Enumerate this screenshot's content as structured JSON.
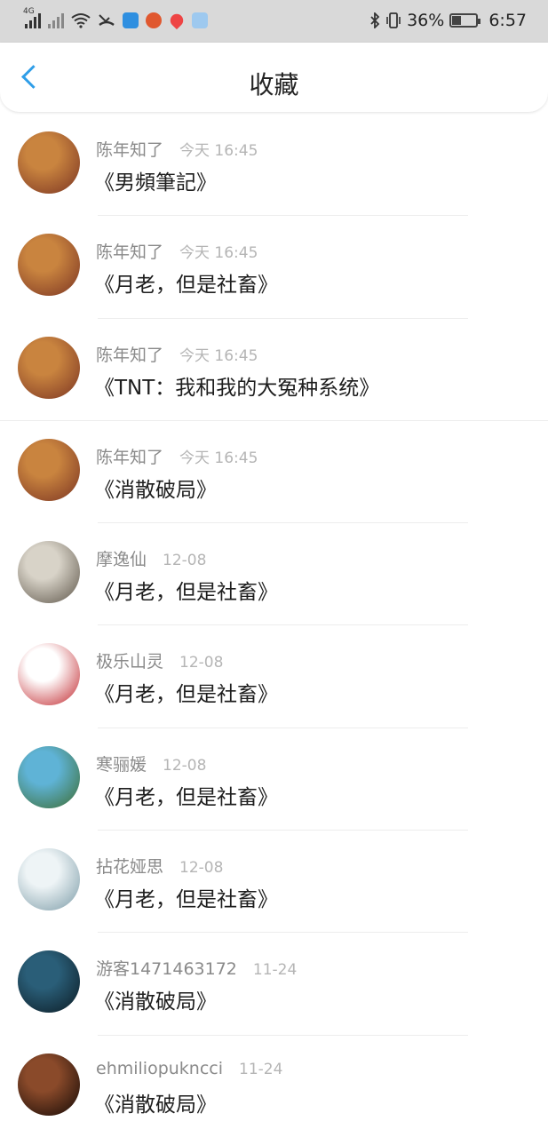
{
  "status_bar": {
    "network": "4G",
    "battery_text": "36%",
    "battery_level": 0.36,
    "time": "6:57"
  },
  "header": {
    "title": "收藏"
  },
  "items": [
    {
      "user": "陈年知了",
      "time": "今天 16:45",
      "book": "《男頻筆記》",
      "avatar_colors": [
        "#c9843f",
        "#7a3322"
      ]
    },
    {
      "user": "陈年知了",
      "time": "今天 16:45",
      "book": "《月老，但是社畜》",
      "avatar_colors": [
        "#c9843f",
        "#7a3322"
      ]
    },
    {
      "user": "陈年知了",
      "time": "今天 16:45",
      "book": "《TNT：我和我的大冤种系统》",
      "avatar_colors": [
        "#c9843f",
        "#7a3322"
      ]
    },
    {
      "user": "陈年知了",
      "time": "今天 16:45",
      "book": "《消散破局》",
      "avatar_colors": [
        "#c9843f",
        "#7a3322"
      ]
    },
    {
      "user": "摩逸仙",
      "time": "12-08",
      "book": "《月老，但是社畜》",
      "avatar_colors": [
        "#d8d3c8",
        "#5c5448"
      ]
    },
    {
      "user": "极乐山灵",
      "time": "12-08",
      "book": "《月老，但是社畜》",
      "avatar_colors": [
        "#ffffff",
        "#c0242a"
      ]
    },
    {
      "user": "寒骊媛",
      "time": "12-08",
      "book": "《月老，但是社畜》",
      "avatar_colors": [
        "#5fb3d6",
        "#3c6b2e"
      ]
    },
    {
      "user": "拈花娅思",
      "time": "12-08",
      "book": "《月老，但是社畜》",
      "avatar_colors": [
        "#eef4f6",
        "#7a9aa6"
      ]
    },
    {
      "user": "游客1471463172",
      "time": "11-24",
      "book": "《消散破局》",
      "avatar_colors": [
        "#2a5e78",
        "#0b1a22"
      ]
    },
    {
      "user": "ehmiliopukncci",
      "time": "11-24",
      "book": "《消散破局》",
      "avatar_colors": [
        "#8a4a2a",
        "#120805"
      ]
    }
  ]
}
